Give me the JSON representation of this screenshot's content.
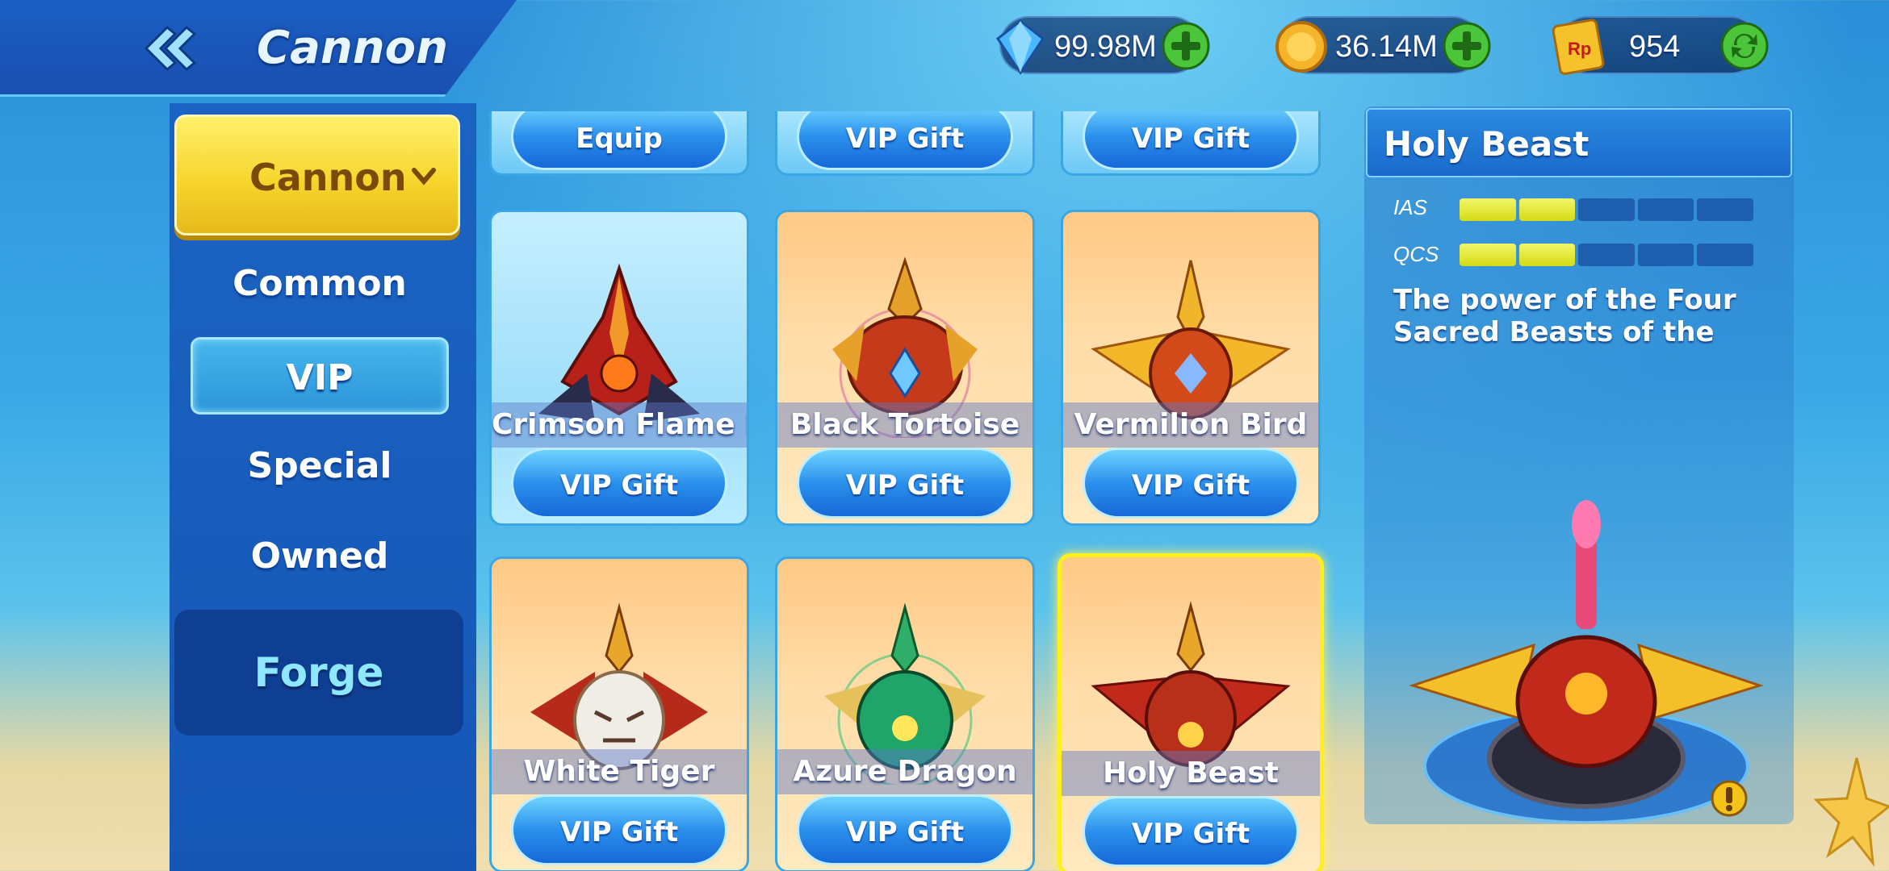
{
  "header": {
    "title": "Cannon",
    "back_icon": "double-chevron-left-icon",
    "currencies": [
      {
        "name": "diamonds",
        "icon": "diamond-icon",
        "value": "99.98M",
        "action_icon": "plus-icon"
      },
      {
        "name": "coins",
        "icon": "coin-icon",
        "value": "36.14M",
        "action_icon": "plus-icon"
      },
      {
        "name": "reward-points",
        "icon": "ticket-icon",
        "icon_text": "Rp",
        "value": "954",
        "action_icon": "refresh-icon"
      }
    ]
  },
  "sidebar": {
    "dropdown_label": "Cannon",
    "items": [
      {
        "label": "Common",
        "active": false
      },
      {
        "label": "VIP",
        "active": true
      },
      {
        "label": "Special",
        "active": false
      },
      {
        "label": "Owned",
        "active": false
      }
    ],
    "forge_label": "Forge"
  },
  "grid": {
    "top_row_buttons": [
      "Equip",
      "VIP Gift",
      "VIP Gift"
    ],
    "cards": [
      {
        "name": "Crimson Flame IV",
        "button": "VIP Gift",
        "theme": "blue",
        "selected": false
      },
      {
        "name": "Black Tortoise",
        "button": "VIP Gift",
        "theme": "orange",
        "selected": false
      },
      {
        "name": "Vermilion Bird",
        "button": "VIP Gift",
        "theme": "orange",
        "selected": false
      },
      {
        "name": "White Tiger",
        "button": "VIP Gift",
        "theme": "orange",
        "selected": false
      },
      {
        "name": "Azure Dragon",
        "button": "VIP Gift",
        "theme": "orange",
        "selected": false
      },
      {
        "name": "Holy Beast",
        "button": "VIP Gift",
        "theme": "orange",
        "selected": true
      }
    ]
  },
  "detail": {
    "title": "Holy Beast",
    "stats": [
      {
        "label": "IAS",
        "level": 2,
        "max": 5
      },
      {
        "label": "QCS",
        "level": 2,
        "max": 5
      }
    ],
    "description": "The power of the Four Sacred Beasts of the"
  },
  "colors": {
    "accent_yellow": "#f7d52d",
    "button_blue": "#2b90ec",
    "stat_on": "#d6db13",
    "stat_off": "#1d5fae",
    "selected_border": "#ffef1f"
  }
}
